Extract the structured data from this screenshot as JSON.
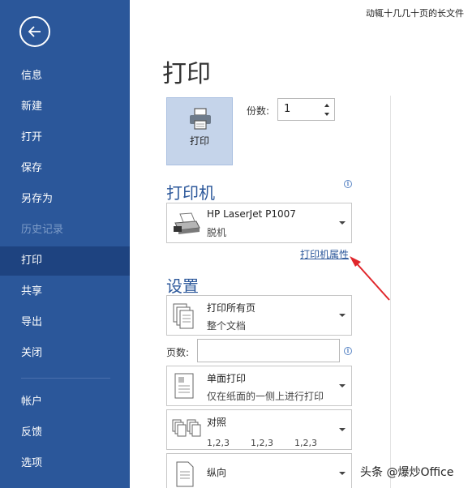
{
  "document_title": "动辄十几几十页的长文件",
  "sidebar": {
    "items": [
      {
        "label": "信息",
        "state": "normal"
      },
      {
        "label": "新建",
        "state": "normal"
      },
      {
        "label": "打开",
        "state": "normal"
      },
      {
        "label": "保存",
        "state": "normal"
      },
      {
        "label": "另存为",
        "state": "normal"
      },
      {
        "label": "历史记录",
        "state": "disabled"
      },
      {
        "label": "打印",
        "state": "active"
      },
      {
        "label": "共享",
        "state": "normal"
      },
      {
        "label": "导出",
        "state": "normal"
      },
      {
        "label": "关闭",
        "state": "normal"
      },
      {
        "label": "帐户",
        "state": "normal"
      },
      {
        "label": "反馈",
        "state": "normal"
      },
      {
        "label": "选项",
        "state": "normal"
      }
    ]
  },
  "main": {
    "title": "打印",
    "print_button_label": "打印",
    "copies_label": "份数:",
    "copies_value": "1"
  },
  "printer": {
    "section_title": "打印机",
    "name": "HP LaserJet P1007",
    "status": "脱机",
    "properties_link": "打印机属性"
  },
  "settings": {
    "section_title": "设置",
    "print_range": {
      "line1": "打印所有页",
      "line2": "整个文档"
    },
    "pages_label": "页数:",
    "pages_value": "",
    "sides": {
      "line1": "单面打印",
      "line2": "仅在纸面的一侧上进行打印"
    },
    "collate": {
      "line1": "对照",
      "sequence": [
        "1,2,3",
        "1,2,3",
        "1,2,3"
      ]
    },
    "orientation": {
      "line1": "纵向"
    }
  },
  "watermark": "头条 @爆炒Office",
  "colors": {
    "sidebar_bg": "#2b579a",
    "sidebar_active": "#1e4380",
    "accent": "#2b579a",
    "annotation_arrow": "#e0262b"
  }
}
